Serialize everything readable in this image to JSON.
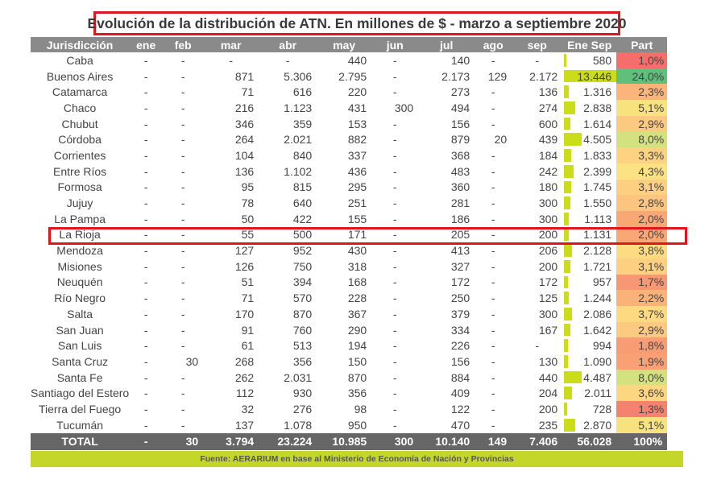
{
  "title": "Evolución de la distribución de ATN. En millones de $ - marzo a septiembre 2020",
  "headers": [
    "Jurisdicción",
    "ene",
    "feb",
    "mar",
    "abr",
    "may",
    "jun",
    "jul",
    "ago",
    "sep",
    "Ene Sep",
    "Part"
  ],
  "rows": [
    {
      "name": "Caba",
      "ene": "-",
      "feb": "-",
      "mar": "-",
      "abr": "-",
      "may": "440",
      "jun": "-",
      "jul": "140",
      "ago": "-",
      "sep": "-",
      "total": "580",
      "part": "1,0%",
      "total_value": 580,
      "part_color": "#f46f6c"
    },
    {
      "name": "Buenos Aires",
      "ene": "-",
      "feb": "-",
      "mar": "871",
      "abr": "5.306",
      "may": "2.795",
      "jun": "-",
      "jul": "2.173",
      "ago": "129",
      "sep": "2.172",
      "total": "13.446",
      "part": "24,0%",
      "total_value": 13446,
      "part_color": "#5fbf7b"
    },
    {
      "name": "Catamarca",
      "ene": "-",
      "feb": "-",
      "mar": "71",
      "abr": "616",
      "may": "220",
      "jun": "-",
      "jul": "273",
      "ago": "-",
      "sep": "136",
      "total": "1.316",
      "part": "2,3%",
      "total_value": 1316,
      "part_color": "#fbb57a"
    },
    {
      "name": "Chaco",
      "ene": "-",
      "feb": "-",
      "mar": "216",
      "abr": "1.123",
      "may": "431",
      "jun": "300",
      "jul": "494",
      "ago": "-",
      "sep": "274",
      "total": "2.838",
      "part": "5,1%",
      "total_value": 2838,
      "part_color": "#f8e27e"
    },
    {
      "name": "Chubut",
      "ene": "-",
      "feb": "-",
      "mar": "346",
      "abr": "359",
      "may": "153",
      "jun": "-",
      "jul": "156",
      "ago": "-",
      "sep": "600",
      "total": "1.614",
      "part": "2,9%",
      "total_value": 1614,
      "part_color": "#fcc980"
    },
    {
      "name": "Córdoba",
      "ene": "-",
      "feb": "-",
      "mar": "264",
      "abr": "2.021",
      "may": "882",
      "jun": "-",
      "jul": "879",
      "ago": "20",
      "sep": "439",
      "total": "4.505",
      "part": "8,0%",
      "total_value": 4505,
      "part_color": "#d3e17f"
    },
    {
      "name": "Corrientes",
      "ene": "-",
      "feb": "-",
      "mar": "104",
      "abr": "840",
      "may": "337",
      "jun": "-",
      "jul": "368",
      "ago": "-",
      "sep": "184",
      "total": "1.833",
      "part": "3,3%",
      "total_value": 1833,
      "part_color": "#fdd281"
    },
    {
      "name": "Entre Ríos",
      "ene": "-",
      "feb": "-",
      "mar": "136",
      "abr": "1.102",
      "may": "436",
      "jun": "-",
      "jul": "483",
      "ago": "-",
      "sep": "242",
      "total": "2.399",
      "part": "4,3%",
      "total_value": 2399,
      "part_color": "#fde283"
    },
    {
      "name": "Formosa",
      "ene": "-",
      "feb": "-",
      "mar": "95",
      "abr": "815",
      "may": "295",
      "jun": "-",
      "jul": "360",
      "ago": "-",
      "sep": "180",
      "total": "1.745",
      "part": "3,1%",
      "total_value": 1745,
      "part_color": "#fdcf81"
    },
    {
      "name": "Jujuy",
      "ene": "-",
      "feb": "-",
      "mar": "78",
      "abr": "640",
      "may": "251",
      "jun": "-",
      "jul": "281",
      "ago": "-",
      "sep": "300",
      "total": "1.550",
      "part": "2,8%",
      "total_value": 1550,
      "part_color": "#fcc57f"
    },
    {
      "name": "La Pampa",
      "ene": "-",
      "feb": "-",
      "mar": "50",
      "abr": "422",
      "may": "155",
      "jun": "-",
      "jul": "186",
      "ago": "-",
      "sep": "300",
      "total": "1.113",
      "part": "2,0%",
      "total_value": 1113,
      "part_color": "#faa776"
    },
    {
      "name": "La Rioja",
      "ene": "-",
      "feb": "-",
      "mar": "55",
      "abr": "500",
      "may": "171",
      "jun": "-",
      "jul": "205",
      "ago": "-",
      "sep": "200",
      "total": "1.131",
      "part": "2,0%",
      "total_value": 1131,
      "part_color": "#faa776"
    },
    {
      "name": "Mendoza",
      "ene": "-",
      "feb": "-",
      "mar": "127",
      "abr": "952",
      "may": "430",
      "jun": "-",
      "jul": "413",
      "ago": "-",
      "sep": "206",
      "total": "2.128",
      "part": "3,8%",
      "total_value": 2128,
      "part_color": "#fddb82"
    },
    {
      "name": "Misiones",
      "ene": "-",
      "feb": "-",
      "mar": "126",
      "abr": "750",
      "may": "318",
      "jun": "-",
      "jul": "327",
      "ago": "-",
      "sep": "200",
      "total": "1.721",
      "part": "3,1%",
      "total_value": 1721,
      "part_color": "#fdcf81"
    },
    {
      "name": "Neuquén",
      "ene": "-",
      "feb": "-",
      "mar": "51",
      "abr": "394",
      "may": "168",
      "jun": "-",
      "jul": "172",
      "ago": "-",
      "sep": "172",
      "total": "957",
      "part": "1,7%",
      "total_value": 957,
      "part_color": "#f89773"
    },
    {
      "name": "Río Negro",
      "ene": "-",
      "feb": "-",
      "mar": "71",
      "abr": "570",
      "may": "228",
      "jun": "-",
      "jul": "250",
      "ago": "-",
      "sep": "125",
      "total": "1.244",
      "part": "2,2%",
      "total_value": 1244,
      "part_color": "#fab278"
    },
    {
      "name": "Salta",
      "ene": "-",
      "feb": "-",
      "mar": "170",
      "abr": "870",
      "may": "367",
      "jun": "-",
      "jul": "379",
      "ago": "-",
      "sep": "300",
      "total": "2.086",
      "part": "3,7%",
      "total_value": 2086,
      "part_color": "#fdd982"
    },
    {
      "name": "San Juan",
      "ene": "-",
      "feb": "-",
      "mar": "91",
      "abr": "760",
      "may": "290",
      "jun": "-",
      "jul": "334",
      "ago": "-",
      "sep": "167",
      "total": "1.642",
      "part": "2,9%",
      "total_value": 1642,
      "part_color": "#fcc980"
    },
    {
      "name": "San Luis",
      "ene": "-",
      "feb": "-",
      "mar": "61",
      "abr": "513",
      "may": "194",
      "jun": "-",
      "jul": "226",
      "ago": "-",
      "sep": "-",
      "total": "994",
      "part": "1,8%",
      "total_value": 994,
      "part_color": "#f99c74"
    },
    {
      "name": "Santa Cruz",
      "ene": "-",
      "feb": "30",
      "mar": "268",
      "abr": "356",
      "may": "150",
      "jun": "-",
      "jul": "156",
      "ago": "-",
      "sep": "130",
      "total": "1.090",
      "part": "1,9%",
      "total_value": 1090,
      "part_color": "#f9a175"
    },
    {
      "name": "Santa Fe",
      "ene": "-",
      "feb": "-",
      "mar": "262",
      "abr": "2.031",
      "may": "870",
      "jun": "-",
      "jul": "884",
      "ago": "-",
      "sep": "440",
      "total": "4.487",
      "part": "8,0%",
      "total_value": 4487,
      "part_color": "#d3e17f"
    },
    {
      "name": "Santiago del Estero",
      "ene": "-",
      "feb": "-",
      "mar": "112",
      "abr": "930",
      "may": "356",
      "jun": "-",
      "jul": "409",
      "ago": "-",
      "sep": "204",
      "total": "2.011",
      "part": "3,6%",
      "total_value": 2011,
      "part_color": "#fdd682"
    },
    {
      "name": "Tierra del Fuego",
      "ene": "-",
      "feb": "-",
      "mar": "32",
      "abr": "276",
      "may": "98",
      "jun": "-",
      "jul": "122",
      "ago": "-",
      "sep": "200",
      "total": "728",
      "part": "1,3%",
      "total_value": 728,
      "part_color": "#f6816f"
    },
    {
      "name": "Tucumán",
      "ene": "-",
      "feb": "-",
      "mar": "137",
      "abr": "1.078",
      "may": "950",
      "jun": "-",
      "jul": "470",
      "ago": "-",
      "sep": "235",
      "total": "2.870",
      "part": "5,1%",
      "total_value": 2870,
      "part_color": "#f8e27e"
    }
  ],
  "total_row": {
    "name": "TOTAL",
    "ene": "-",
    "feb": "30",
    "mar": "3.794",
    "abr": "23.224",
    "may": "10.985",
    "jun": "300",
    "jul": "10.140",
    "ago": "149",
    "sep": "7.406",
    "total": "56.028",
    "part": "100%"
  },
  "footer": "Fuente: AERARIUM en base al Ministerio de Economía de Nación y Provincias",
  "highlighted_row": "La Rioja",
  "colors": {
    "header_bg": "#8a8a8a",
    "total_bg": "#666666",
    "bar": "#cadc1a",
    "footer_bg": "#c4d62a",
    "highlight": "#e0161f"
  },
  "bar_max": 13446
}
